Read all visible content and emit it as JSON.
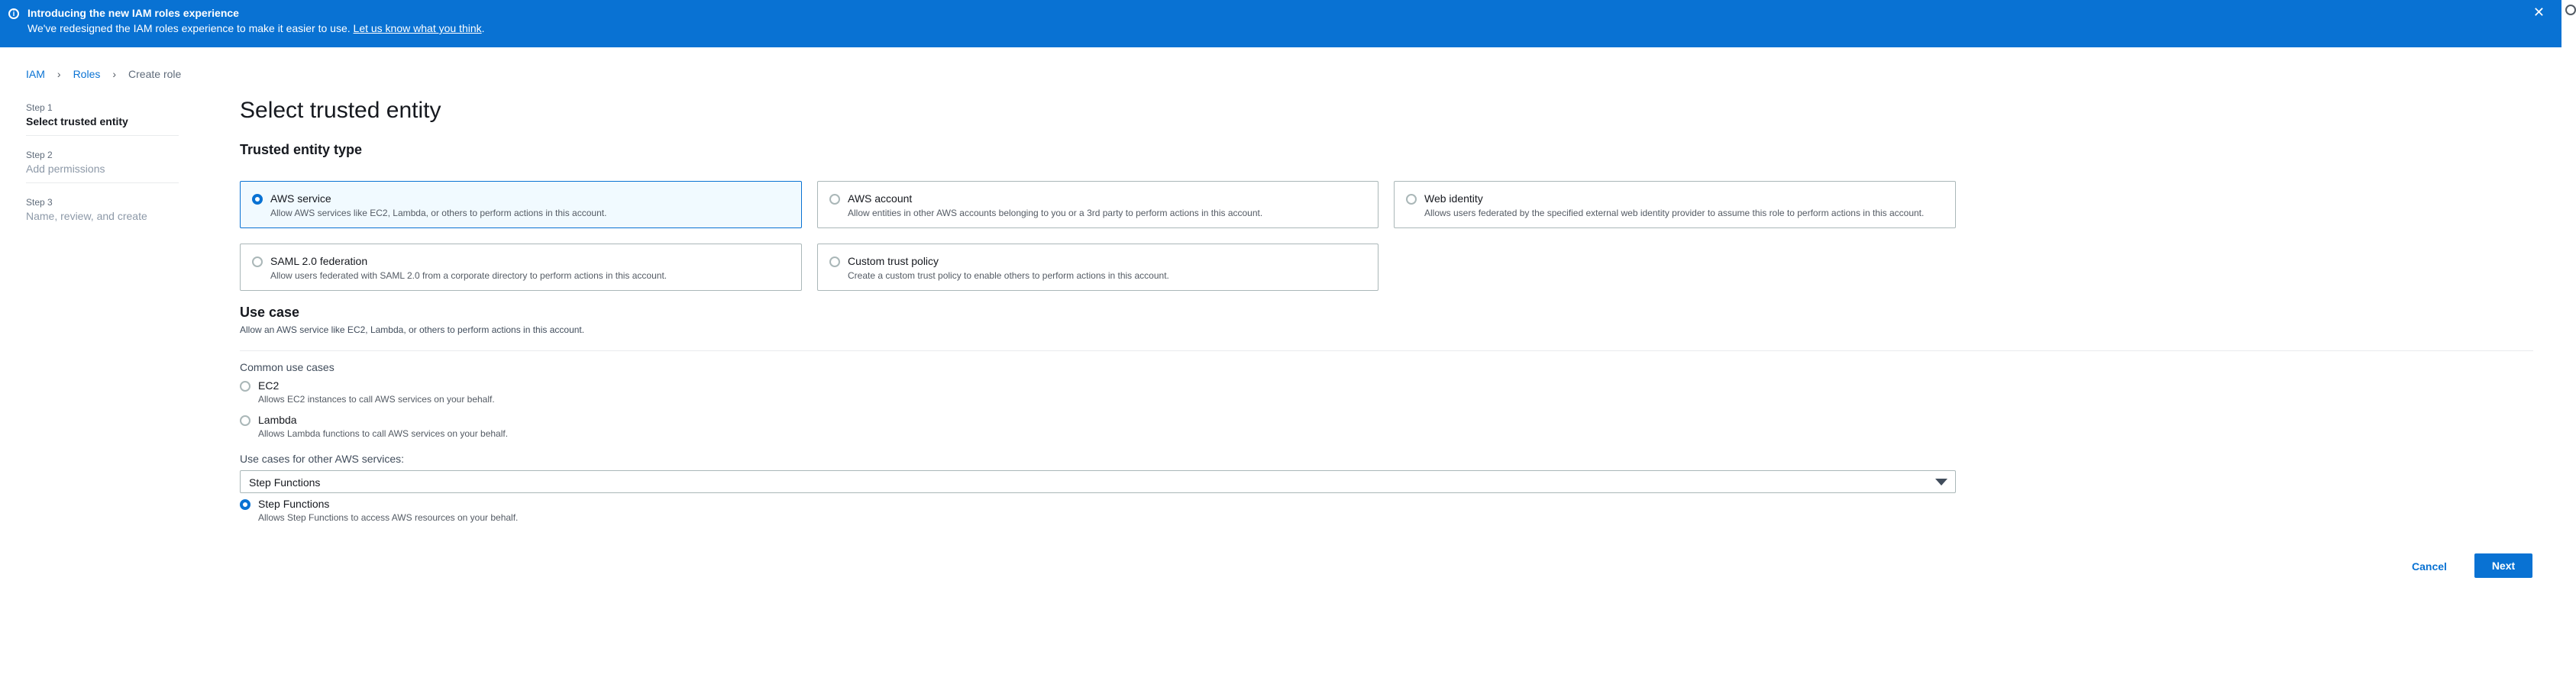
{
  "banner": {
    "title": "Introducing the new IAM roles experience",
    "message": "We've redesigned the IAM roles experience to make it easier to use.",
    "link": "Let us know what you think",
    "period": "."
  },
  "breadcrumb": {
    "iam": "IAM",
    "roles": "Roles",
    "current": "Create role"
  },
  "steps": [
    {
      "num": "Step 1",
      "label": "Select trusted entity"
    },
    {
      "num": "Step 2",
      "label": "Add permissions"
    },
    {
      "num": "Step 3",
      "label": "Name, review, and create"
    }
  ],
  "page_title": "Select trusted entity",
  "trusted_entity": {
    "heading": "Trusted entity type",
    "options": [
      {
        "title": "AWS service",
        "desc": "Allow AWS services like EC2, Lambda, or others to perform actions in this account."
      },
      {
        "title": "AWS account",
        "desc": "Allow entities in other AWS accounts belonging to you or a 3rd party to perform actions in this account."
      },
      {
        "title": "Web identity",
        "desc": "Allows users federated by the specified external web identity provider to assume this role to perform actions in this account."
      },
      {
        "title": "SAML 2.0 federation",
        "desc": "Allow users federated with SAML 2.0 from a corporate directory to perform actions in this account."
      },
      {
        "title": "Custom trust policy",
        "desc": "Create a custom trust policy to enable others to perform actions in this account."
      }
    ]
  },
  "use_case": {
    "heading": "Use case",
    "subtitle": "Allow an AWS service like EC2, Lambda, or others to perform actions in this account.",
    "common_label": "Common use cases",
    "common": [
      {
        "title": "EC2",
        "desc": "Allows EC2 instances to call AWS services on your behalf."
      },
      {
        "title": "Lambda",
        "desc": "Allows Lambda functions to call AWS services on your behalf."
      }
    ],
    "other_label": "Use cases for other AWS services:",
    "select_value": "Step Functions",
    "selected": {
      "title": "Step Functions",
      "desc": "Allows Step Functions to access AWS resources on your behalf."
    }
  },
  "actions": {
    "cancel": "Cancel",
    "next": "Next"
  }
}
